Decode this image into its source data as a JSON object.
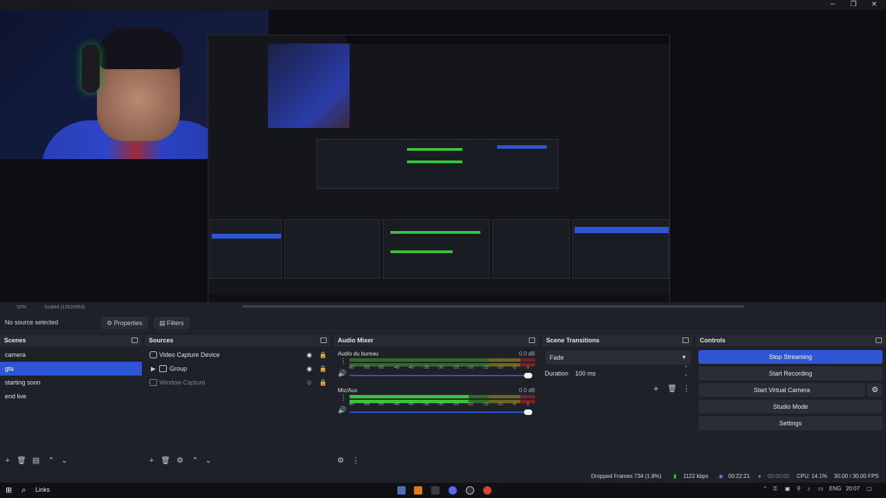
{
  "preview": {
    "zoom": "52%",
    "scaled": "Scaled (1002x563)"
  },
  "source_bar": {
    "no_source": "No source selected",
    "properties": "Properties",
    "filters": "Filters"
  },
  "scenes": {
    "title": "Scenes",
    "items": [
      "camera",
      "gta",
      "starting soon",
      "end live"
    ],
    "selected": 1
  },
  "sources": {
    "title": "Sources",
    "items": [
      {
        "label": "Video Capture Device",
        "icon": "camera-icon"
      },
      {
        "label": "Group",
        "icon": "folder-icon"
      },
      {
        "label": "Window Capture",
        "icon": "window-icon"
      }
    ]
  },
  "mixer": {
    "title": "Audio Mixer",
    "channels": [
      {
        "name": "Audio du bureau",
        "db": "0.0 dB",
        "level": 0.0
      },
      {
        "name": "Mic/Aux",
        "db": "0.0 dB",
        "level": 0.64
      }
    ],
    "ticks": [
      "-60",
      "-55",
      "-50",
      "-45",
      "-40",
      "-35",
      "-30",
      "-25",
      "-20",
      "-15",
      "-10",
      "-5",
      "0"
    ]
  },
  "transitions": {
    "title": "Scene Transitions",
    "selected": "Fade",
    "duration_label": "Duration",
    "duration_value": "100 ms"
  },
  "controls": {
    "title": "Controls",
    "stop_streaming": "Stop Streaming",
    "start_recording": "Start Recording",
    "start_virtual_camera": "Start Virtual Camera",
    "studio_mode": "Studio Mode",
    "settings": "Settings"
  },
  "status": {
    "dropped": "Dropped Frames 734 (1.8%)",
    "bitrate": "1122 kbps",
    "live_time": "00:22:21",
    "rec_time": "00:00:00",
    "cpu": "CPU: 14.1%",
    "fps": "30.00 / 30.00 FPS"
  },
  "taskbar": {
    "search_text": "Links",
    "lang": "ENG",
    "time": "20:07"
  },
  "colors": {
    "accent": "#2f55d4",
    "green": "#3ac23a",
    "yellow": "#b9b431",
    "red": "#b5252c"
  }
}
